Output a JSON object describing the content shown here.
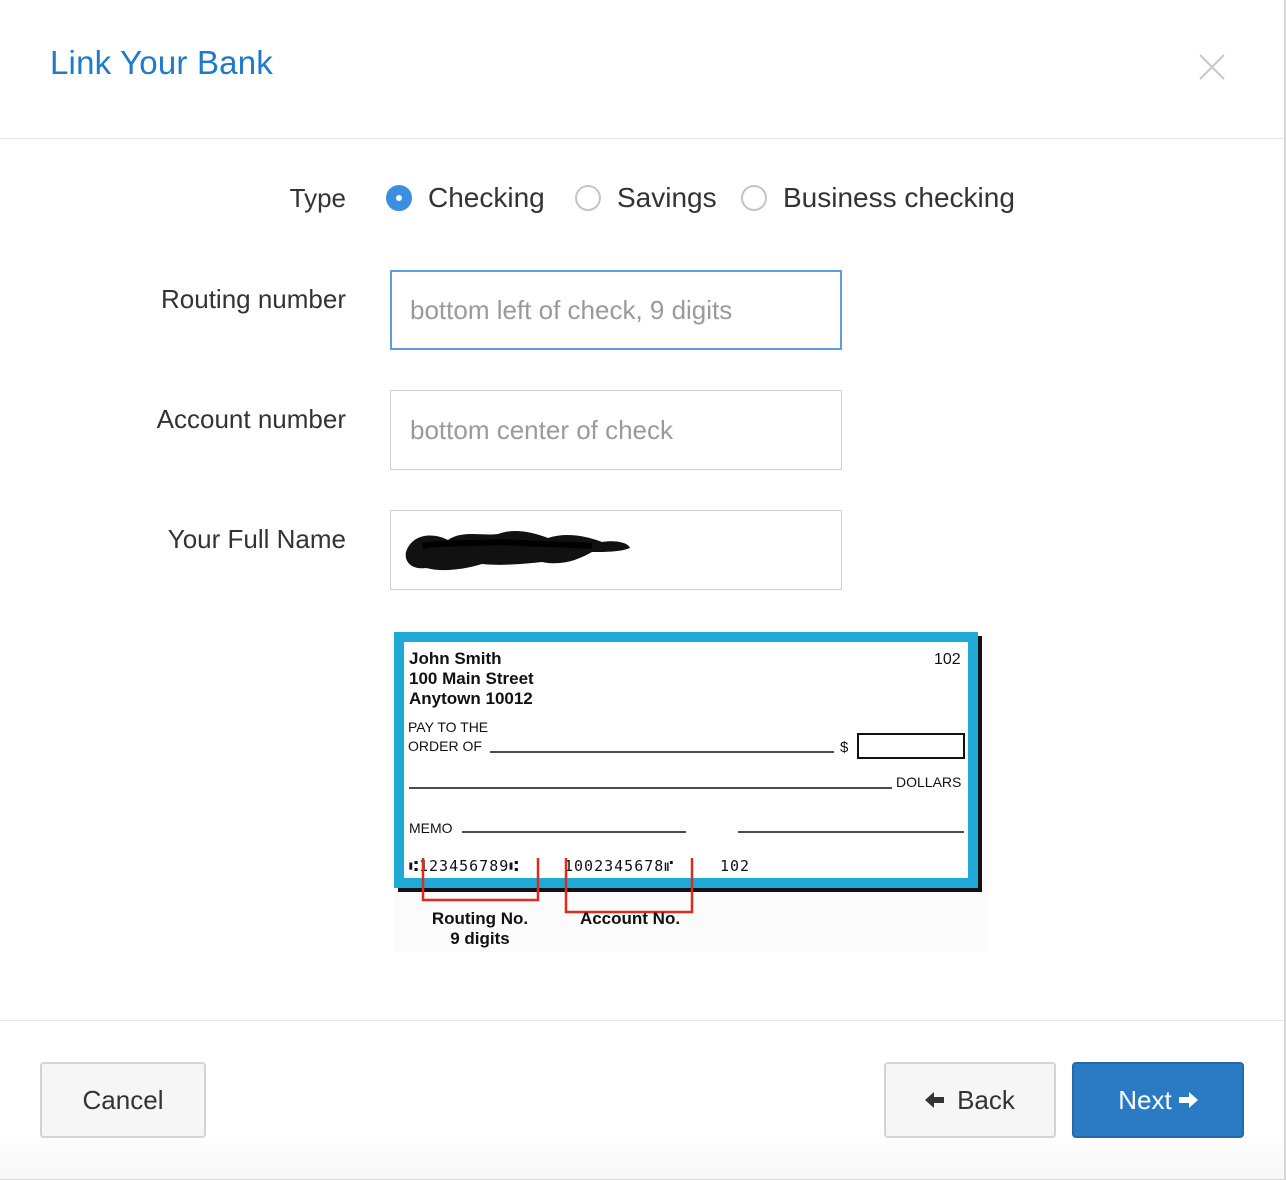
{
  "header": {
    "title": "Link Your Bank",
    "close_icon": "close-icon"
  },
  "form": {
    "type_label": "Type",
    "account_types": [
      {
        "label": "Checking",
        "checked": true
      },
      {
        "label": "Savings",
        "checked": false
      },
      {
        "label": "Business checking",
        "checked": false
      }
    ],
    "routing": {
      "label": "Routing number",
      "placeholder": "bottom left of check, 9 digits",
      "value": ""
    },
    "account": {
      "label": "Account number",
      "placeholder": "bottom center of check",
      "value": ""
    },
    "fullname": {
      "label": "Your Full Name"
    }
  },
  "check_image": {
    "name": "John Smith",
    "street": "100 Main Street",
    "city": "Anytown 10012",
    "check_number": "102",
    "pay_to_line1": "PAY TO THE",
    "pay_to_line2": "ORDER OF",
    "dollar_sign": "$",
    "dollars": "DOLLARS",
    "memo": "MEMO",
    "micr_routing": "⑆123456789⑆",
    "micr_account": "1002345678⑈",
    "micr_check": "102",
    "routing_caption_1": "Routing No.",
    "routing_caption_2": "9 digits",
    "account_caption": "Account No.",
    "border_color": "#1ea9d6",
    "bracket_color": "#e02a20"
  },
  "footer": {
    "cancel_label": "Cancel",
    "back_label": "Back",
    "next_label": "Next",
    "back_icon": "arrow-left-icon",
    "next_icon": "arrow-right-icon"
  },
  "colors": {
    "accent": "#1f7ac9",
    "primary_button": "#2b7bc4"
  }
}
